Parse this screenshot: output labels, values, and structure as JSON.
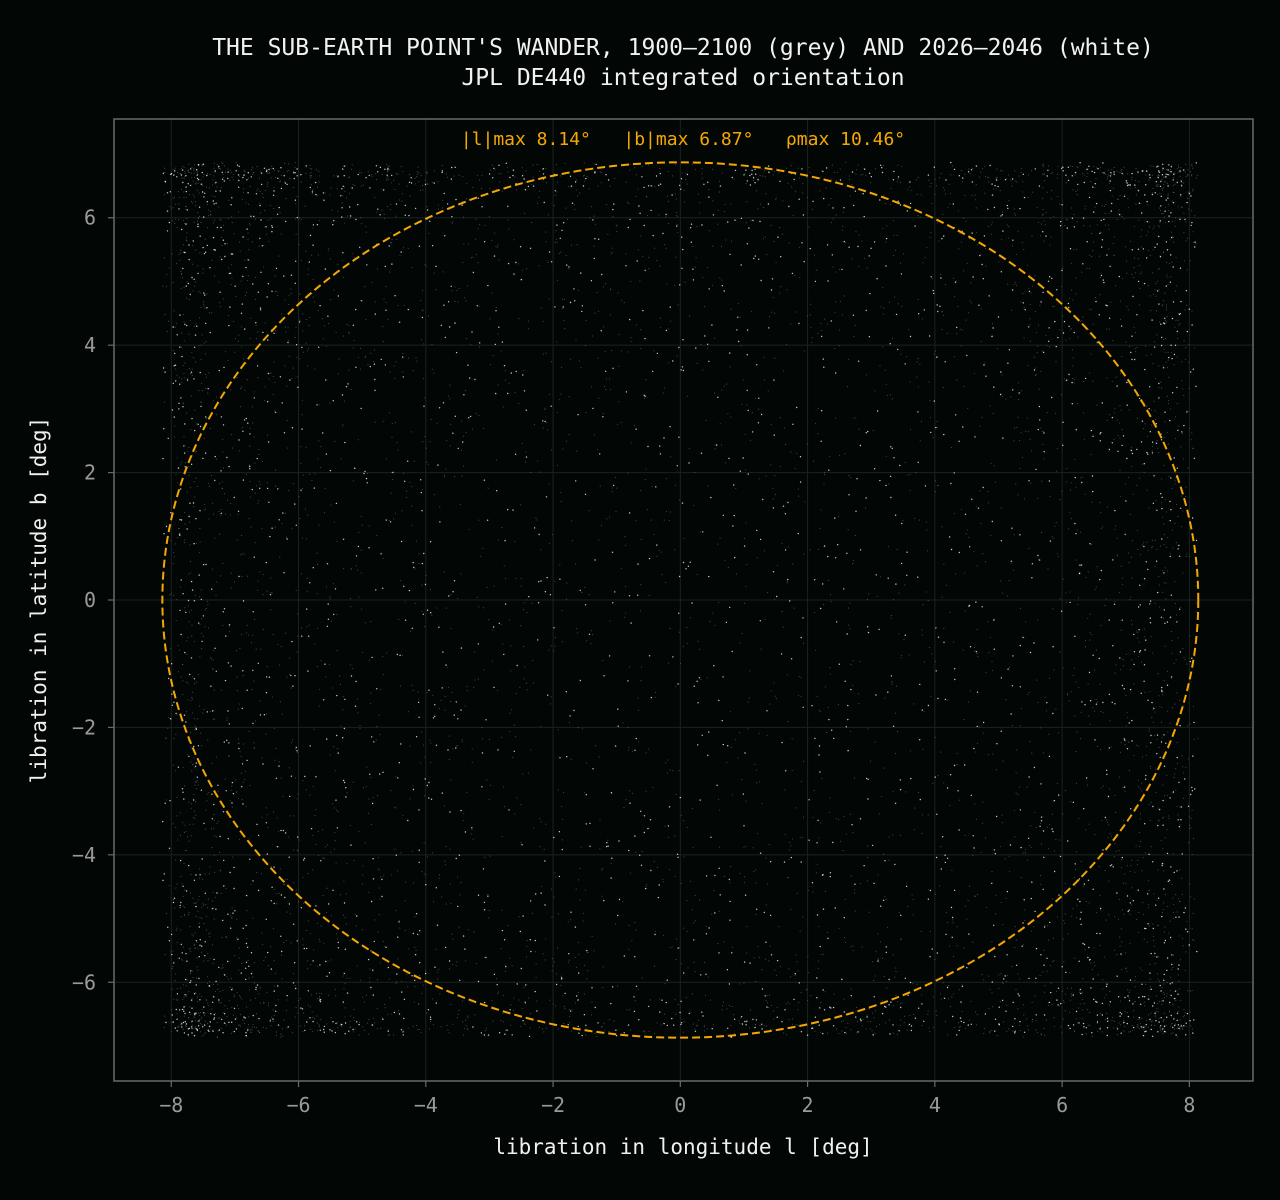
{
  "chart_data": {
    "type": "scatter",
    "title": "THE SUB-EARTH POINT'S WANDER, 1900–2100 (grey) AND 2026–2046 (white)",
    "subtitle": "JPL DE440 integrated orientation",
    "xlabel": "libration in longitude l [deg]",
    "ylabel": "libration in latitude b [deg]",
    "xlim": [
      -8.9,
      9.0
    ],
    "ylim": [
      -7.55,
      7.55
    ],
    "xticks": [
      -8,
      -6,
      -4,
      -2,
      0,
      2,
      4,
      6,
      8
    ],
    "yticks": [
      -6,
      -4,
      -2,
      0,
      2,
      4,
      6
    ],
    "xtick_labels": [
      "−8",
      "−6",
      "−4",
      "−2",
      "0",
      "2",
      "4",
      "6",
      "8"
    ],
    "ytick_labels": [
      "−6",
      "−4",
      "−2",
      "0",
      "2",
      "4",
      "6"
    ],
    "grid": true,
    "annotation": "|l|max 8.14°   |b|max 6.87°   ρmax 10.46°",
    "envelope": {
      "style": "dashed ellipse",
      "l_max": 8.14,
      "b_max": 6.87,
      "color": "#f5a800"
    },
    "series": [
      {
        "name": "1900–2100",
        "color": "#8a8a8a",
        "l_range": [
          -8.14,
          8.14
        ],
        "b_range": [
          -6.87,
          6.87
        ]
      },
      {
        "name": "2026–2046",
        "color": "#ffffff",
        "l_range": [
          -8.14,
          8.14
        ],
        "b_range": [
          -6.87,
          6.87
        ]
      }
    ]
  },
  "colors": {
    "background": "#020706",
    "axes_frame": "#6a6a6a",
    "grid": "#1b2220",
    "ellipse": "#f5a800"
  }
}
